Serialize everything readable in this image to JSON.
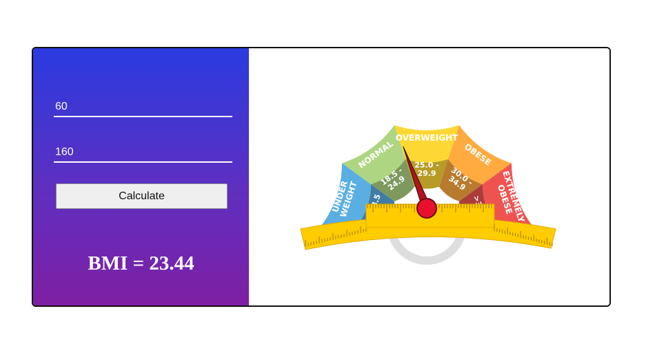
{
  "form": {
    "weight_value": "60",
    "height_value": "160",
    "calculate_label": "Calculate"
  },
  "result": {
    "label": "BMI = 23.44",
    "bmi": 23.44
  },
  "gauge": {
    "categories": [
      {
        "name_lines": [
          "UNDER",
          "WEIGHT"
        ],
        "range_lines": [
          "< 18.5"
        ],
        "color": "#5aaee2"
      },
      {
        "name_lines": [
          "NORMAL"
        ],
        "range_lines": [
          "18.5 -",
          "24.9"
        ],
        "color": "#aed581"
      },
      {
        "name_lines": [
          "OVERWEIGHT"
        ],
        "range_lines": [
          "25.0 -",
          "29.9"
        ],
        "color": "#fdd835"
      },
      {
        "name_lines": [
          "OBESE"
        ],
        "range_lines": [
          "30.0 -",
          "34.9"
        ],
        "color": "#ffab40"
      },
      {
        "name_lines": [
          "EXTREMELY",
          "OBESE"
        ],
        "range_lines": [
          ">35.0"
        ],
        "color": "#ef5350"
      }
    ],
    "needle_color": "#e8112d",
    "ruler_color": "#ffcc00"
  }
}
